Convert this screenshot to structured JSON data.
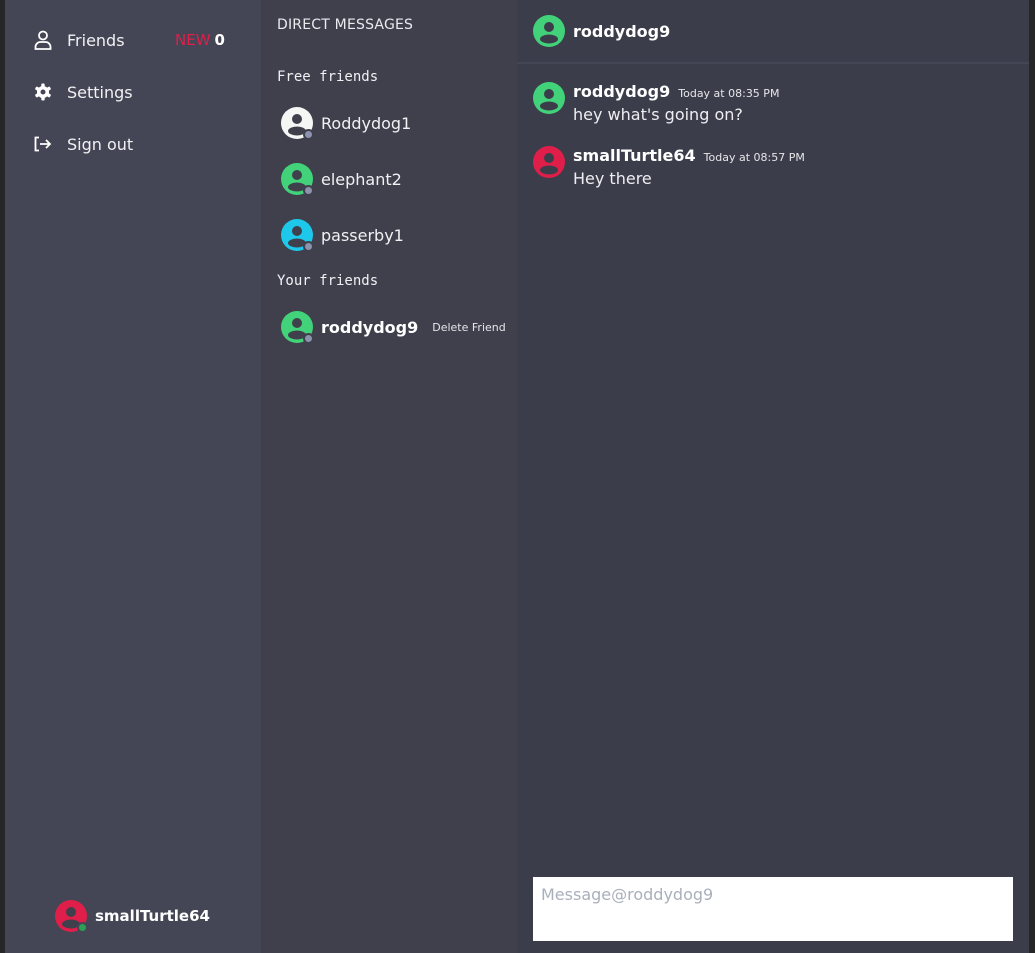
{
  "sidebar": {
    "items": [
      {
        "label": "Friends",
        "icon": "user-icon"
      },
      {
        "label": "Settings",
        "icon": "gear-icon"
      },
      {
        "label": "Sign out",
        "icon": "sign-out-icon"
      }
    ],
    "new_badge": {
      "label": "NEW",
      "count": "0"
    },
    "current_user": {
      "name": "smallTurtle64",
      "avatar_color": "#e01e4a",
      "status_color": "#2e9e54"
    }
  },
  "direct_messages": {
    "title": "DIRECT MESSAGES",
    "free_friends_title": "Free friends",
    "free_friends": [
      {
        "name": "Roddydog1",
        "avatar_color": "#f4f7f4"
      },
      {
        "name": "elephant2",
        "avatar_color": "#42d37a"
      },
      {
        "name": "passerby1",
        "avatar_color": "#1ec8ea"
      }
    ],
    "your_friends_title": "Your friends",
    "your_friends": [
      {
        "name": "roddydog9",
        "avatar_color": "#42d37a",
        "action": "Delete Friend"
      }
    ],
    "status_color": "#8b93ad"
  },
  "chat": {
    "header": {
      "name": "roddydog9",
      "avatar_color": "#42d37a"
    },
    "messages": [
      {
        "author": "roddydog9",
        "time": "Today at 08:35 PM",
        "text": "hey what's going on?",
        "avatar_color": "#42d37a"
      },
      {
        "author": "smallTurtle64",
        "time": "Today at 08:57 PM",
        "text": "Hey there",
        "avatar_color": "#e01e4a"
      }
    ],
    "composer": {
      "placeholder": "Message@roddydog9",
      "value": ""
    }
  }
}
